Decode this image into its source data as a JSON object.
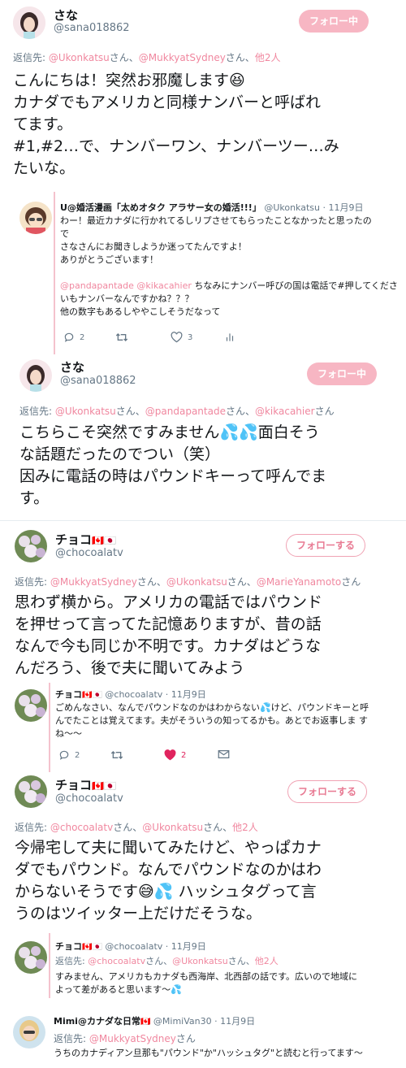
{
  "tweet1": {
    "name": "さな",
    "handle": "@sana018862",
    "follow": "フォロー中",
    "reply_prefix": "返信先: ",
    "reply_link1": "@Ukonkatsu",
    "reply_mid1": "さん、",
    "reply_link2": "@MukkyatSydney",
    "reply_mid2": "さん、",
    "reply_rest": "他2人",
    "lines": [
      "こんにちは！突然お邪魔します",
      "カナダでもアメリカと同様ナンバーと呼ばれ",
      "てます。",
      "#1,#2…で、ナンバーワン、ナンバーツー…み",
      "たいな。"
    ],
    "emoji": "😆"
  },
  "nested1": {
    "name": "U@婚活漫画「太めオタク アラサー女の婚活!!!」",
    "handle": "@Ukonkatsu",
    "date": "· 11月9日",
    "lines": [
      "わー！最近カナダに行かれてるしリプさせてもらったことなかったと思ったの",
      "で",
      "さなさんにお聞きしようか迷ってたんですよ！",
      "ありがとうございます！"
    ],
    "mention1": "@pandapantade",
    "mention2": "@kikacahier",
    "line5_rest": " ちなみにナンバー呼びの国は電話で#押してくださ",
    "lines2": [
      "いもナンバーなんですかね？？？",
      "他の数字もあるしややこしそうだなって"
    ],
    "replies": "2",
    "retweets": "",
    "likes": "3"
  },
  "tweet2": {
    "name": "さな",
    "handle": "@sana018862",
    "follow": "フォロー中",
    "reply_prefix": "返信先: ",
    "reply_link1": "@Ukonkatsu",
    "reply_mid1": "さん、",
    "reply_link2": "@pandapantade",
    "reply_mid2": "さん、",
    "reply_link3": "@kikacahier",
    "reply_end": "さん",
    "line1": "こちらこそ突然ですみません",
    "line1_end": "面白そう",
    "lines": [
      "な話題だったのでつい（笑）",
      "因みに電話の時はパウンドキーって呼んでま",
      "す。"
    ],
    "emoji": "💦💦"
  },
  "tweet3": {
    "name": "チョコ",
    "flags": "🇨🇦🇯🇵",
    "handle": "@chocoalatv",
    "follow": "フォローする",
    "reply_prefix": "返信先: ",
    "reply_link1": "@MukkyatSydney",
    "reply_mid1": "さん、",
    "reply_link2": "@Ukonkatsu",
    "reply_mid2": "さん、",
    "reply_link3": "@MarieYanamoto",
    "reply_end": "さん",
    "lines": [
      "思わず横から。アメリカの電話ではパウンド",
      "を押せって言ってた記憶ありますが、昔の話",
      "なんで今も同じか不明です。カナダはどうな",
      "んだろう、後で夫に聞いてみよう"
    ]
  },
  "nested2": {
    "name": "チョコ",
    "flags": "🇨🇦🇯🇵",
    "handle": "@chocoalatv",
    "date": "· 11月9日",
    "line1": "ごめんなさい、なんでパウンドなのかはわからない",
    "line1_end": "けど、パウンドキーと呼",
    "emoji": "💦",
    "lines": [
      "んでたことは覚えてます。夫がそういうの知ってるかも。あとでお返事しま す",
      "ね〜〜"
    ],
    "replies": "2",
    "likes": "2"
  },
  "tweet4": {
    "name": "チョコ",
    "flags": "🇨🇦🇯🇵",
    "handle": "@chocoalatv",
    "follow": "フォローする",
    "reply_prefix": "返信先: ",
    "reply_link1": "@chocoalatv",
    "reply_mid1": "さん、",
    "reply_link2": "@Ukonkatsu",
    "reply_mid2": "さん、",
    "reply_rest": "他2人",
    "lines": [
      "今帰宅して夫に聞いてみたけど、やっぱカナ",
      "ダでもパウンド。なんでパウンドなのかはわ"
    ],
    "line3": "からないそうです",
    "line3_end": " ハッシュタグって言",
    "emoji": "😅💦",
    "line4": "うのはツイッター上だけだそうな。"
  },
  "nested3": {
    "name": "チョコ",
    "flags": "🇨🇦🇯🇵",
    "handle": "@chocoalatv",
    "date": "· 11月9日",
    "reply_prefix": "返信先: ",
    "reply_link1": "@chocoalatv",
    "reply_mid1": "さん、",
    "reply_link2": "@Ukonkatsu",
    "reply_mid2": "さん、",
    "reply_rest": "他2人",
    "lines": [
      "すみません、アメリカもカナダも西海岸、北西部の話です。広いので地域に"
    ],
    "line2": "よって差があると思います〜",
    "emoji": "💦"
  },
  "tweet5": {
    "name": "Mimi@カナダな日常",
    "flag": "🇨🇦",
    "handle": "@MimiVan30",
    "date": "· 11月9日",
    "reply_prefix": "返信先: ",
    "reply_link1": "@MukkyatSydney",
    "reply_end": "さん",
    "line1": "うちのカナディアン旦那も\"パウンド\"か\"ハッシュタグ\"と読むと行ってます〜"
  },
  "colors": {
    "accent": "#f0879f",
    "follow_bg": "#f7b6c3",
    "text": "#14171a",
    "muted": "#657786"
  }
}
